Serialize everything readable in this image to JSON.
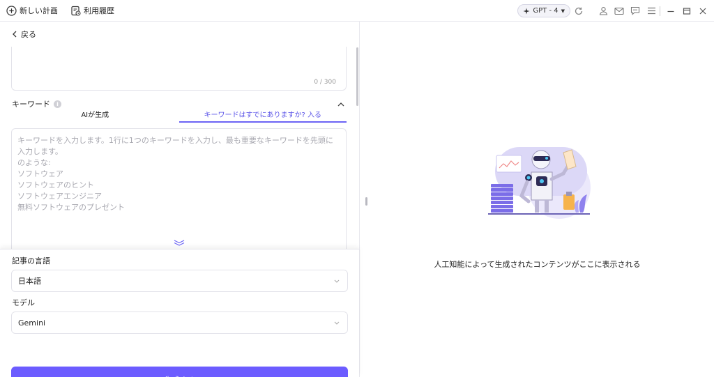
{
  "toolbar": {
    "new_plan_label": "新しい計画",
    "history_label": "利用履歴",
    "model_pill": "GPT - 4",
    "icons": [
      "user-icon",
      "mail-icon",
      "chat-icon",
      "menu-icon",
      "minimize-icon",
      "restore-icon",
      "close-icon"
    ]
  },
  "left": {
    "back_label": "戻る",
    "description": {
      "counter": "0 / 300"
    },
    "keywords": {
      "title": "キーワード",
      "tabs": [
        {
          "label": "AIが生成",
          "active": false
        },
        {
          "label": "キーワードはすでにありますか? 入る",
          "active": true
        }
      ],
      "placeholder": "キーワードを入力します。1行に1つのキーワードを入力し、最も重要なキーワードを先頭に入力します。\nのような:\nソフトウェア\nソフトウェアのヒント\nソフトウェアエンジニア\n無料ソフトウェアのプレゼント"
    },
    "language": {
      "label": "記事の言語",
      "value": "日本語"
    },
    "model": {
      "label": "モデル",
      "value": "Gemini"
    },
    "generate_label": "生成する"
  },
  "right": {
    "message": "人工知能によって生成されたコンテンツがここに表示される"
  },
  "colors": {
    "accent": "#6c5cff",
    "tab_active": "#5b54e8",
    "border": "#e3e3ea"
  }
}
